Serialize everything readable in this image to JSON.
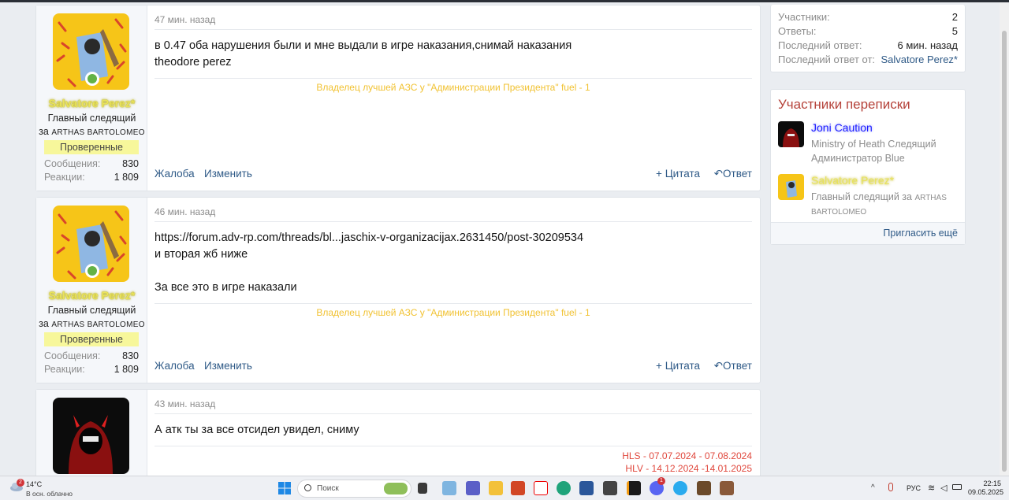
{
  "posts": [
    {
      "time": "47 мин. назад",
      "user": {
        "name": "Salvatore Perez*",
        "title_main": "Главный следящий",
        "title_prefix": "за",
        "title_sc": "ARTHAS BARTOLOMEO",
        "badge": "Проверенные",
        "messages_label": "Сообщения:",
        "messages": "830",
        "reactions_label": "Реакции:",
        "reactions": "1 809"
      },
      "lines": [
        "в 0.47 оба нарушения были и мне выдали в игре наказания,снимай наказания",
        "theodore perez"
      ],
      "signature": "Владелец лучшей АЗС у \"Администрации Президента\" fuel - 1",
      "actions": {
        "report": "Жалоба",
        "edit": "Изменить",
        "quote": "Цитата",
        "reply": "Ответ"
      }
    },
    {
      "time": "46 мин. назад",
      "user": {
        "name": "Salvatore Perez*",
        "title_main": "Главный следящий",
        "title_prefix": "за",
        "title_sc": "ARTHAS BARTOLOMEO",
        "badge": "Проверенные",
        "messages_label": "Сообщения:",
        "messages": "830",
        "reactions_label": "Реакции:",
        "reactions": "1 809"
      },
      "lines": [
        "https://forum.adv-rp.com/threads/bl...jaschix-v-organizacijax.2631450/post-30209534",
        "и вторая жб ниже",
        "",
        "За все это в игре наказали"
      ],
      "signature": "Владелец лучшей АЗС у \"Администрации Президента\" fuel - 1",
      "actions": {
        "report": "Жалоба",
        "edit": "Изменить",
        "quote": "Цитата",
        "reply": "Ответ"
      }
    },
    {
      "time": "43 мин. назад",
      "lines": [
        "А атк ты за все отсидел увидел, сниму"
      ],
      "signature_lines": [
        "HLS - 07.07.2024 - 07.08.2024",
        "HLV - 14.12.2024 -14.01.2025"
      ]
    }
  ],
  "sidebar": {
    "stats": [
      {
        "label": "Участники:",
        "value": "2"
      },
      {
        "label": "Ответы:",
        "value": "5"
      },
      {
        "label": "Последний ответ:",
        "value": "6 мин. назад"
      },
      {
        "label": "Последний ответ от:",
        "value": "Salvatore Perez*"
      }
    ],
    "participants_title": "Участники переписки",
    "participants": [
      {
        "name": "Joni Caution",
        "title_lines": [
          "Ministry of Heath Следящий",
          "Администратор Blue"
        ]
      },
      {
        "name": "Salvatore Perez*",
        "title_main": "Главный следящий за",
        "title_sc": "ARTHAS",
        "title_sc2": "BARTOLOMEO"
      }
    ],
    "invite": "Пригласить ещё"
  },
  "taskbar": {
    "weather_badge": "2",
    "temp": "14°C",
    "condition": "В осн. облачно",
    "search_placeholder": "Поиск",
    "discord_badge": "1",
    "lang": "РУС",
    "time": "22:15",
    "date": "09.05.2025"
  },
  "colors": {
    "accent_link": "#2f5a87",
    "username_gold": "#e9e35b",
    "signature_gold": "#f1c232",
    "signature_red": "#e0473c",
    "badge_yellow": "#f7f79b",
    "online": "#63b246"
  }
}
